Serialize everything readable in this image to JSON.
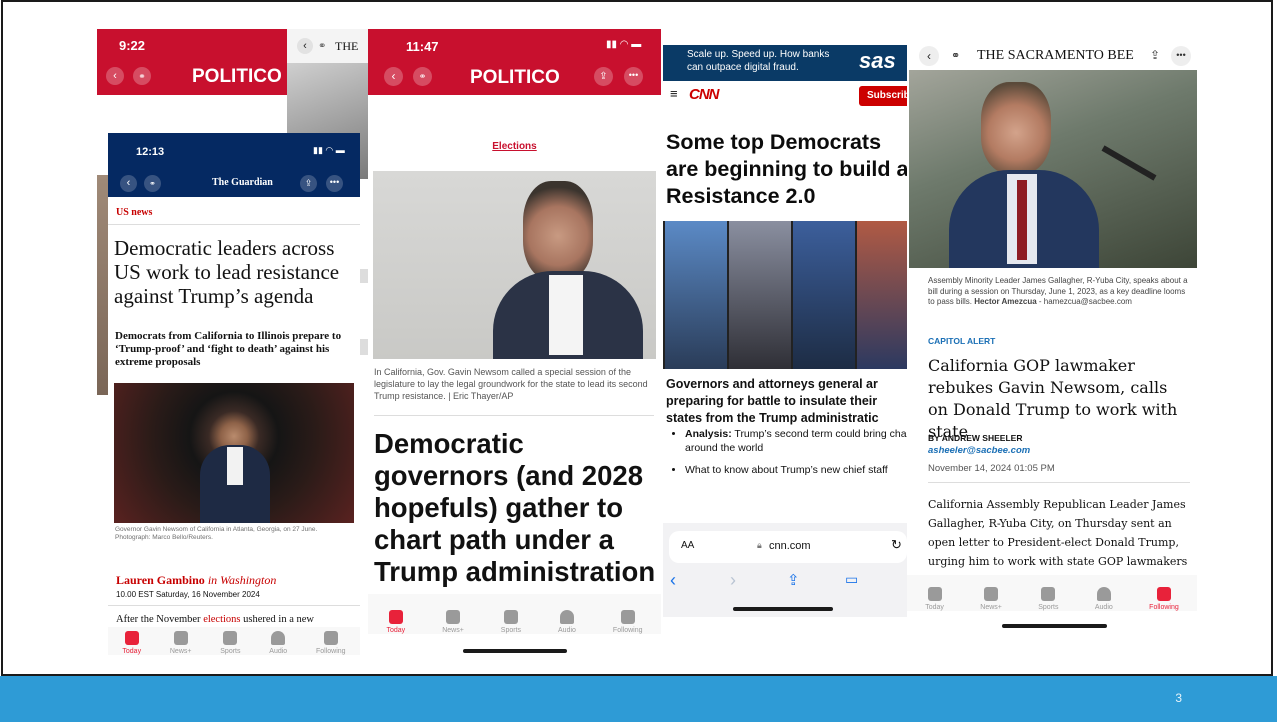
{
  "slide": {
    "page_number": "3"
  },
  "politico_back": {
    "time": "9:22",
    "brand": "POLITICO"
  },
  "sacbee_partial": {
    "brand": "THE"
  },
  "guardian": {
    "time": "12:13",
    "brand": "The Guardian",
    "section": "US news",
    "headline": "Democratic leaders across US work to lead resistance against Trump’s agenda",
    "standfirst": "Democrats from California to Illinois prepare to ‘Trump-proof’ and ‘fight to death’ against his extreme proposals",
    "caption": "Governor Gavin Newsom of California in Atlanta, Georgia, on 27 June. Photograph: Marco Bello/Reuters.",
    "author": "Lauren Gambino",
    "author_location": "in Washington",
    "dateline": "10.00 EST Saturday, 16 November 2024",
    "body_start": "After the November",
    "body_link": "elections",
    "body_end": "ushered in a new",
    "tabs": [
      "Today",
      "News+",
      "Sports",
      "Audio",
      "Following"
    ]
  },
  "politico": {
    "time": "11:47",
    "brand": "POLITICO",
    "section": "Elections",
    "caption": "In California, Gov. Gavin Newsom called a special session of the legislature to lay the legal groundwork for the state to lead its second Trump resistance. | Eric Thayer/AP",
    "headline": "Democratic governors (and 2028 hopefuls) gather to chart path under a Trump administration",
    "tabs": [
      "Today",
      "News+",
      "Sports",
      "Audio",
      "Following"
    ]
  },
  "cnn": {
    "ad_text": "Scale up. Speed up. How banks can outpace digital fraud.",
    "ad_brand": "sas",
    "brand": "CNN",
    "subscribe": "Subscrib",
    "headline": "Some top Democrats are beginning to build a Resistance 2.0",
    "subhead": "Governors and attorneys general ar preparing for battle to insulate their states from the Trump administratic",
    "bullets": [
      {
        "bold": "Analysis:",
        "text": " Trump’s second term could bring chaos around the world"
      },
      {
        "bold": "",
        "text": "What to know about Trump’s new chief staff"
      }
    ],
    "text_size": "AA",
    "url": "cnn.com"
  },
  "sacbee": {
    "brand": "THE SACRAMENTO BEE",
    "caption": "Assembly Minority Leader James Gallagher, R-Yuba City, speaks about a bill during a session on Thursday, June 1, 2023, as a key deadline looms to pass bills.",
    "caption_credit": "Hector Amezcua",
    "caption_email": "hamezcua@sacbee.com",
    "kicker": "CAPITOL ALERT",
    "headline": "California GOP lawmaker rebukes Gavin Newsom, calls on Donald Trump to work with state",
    "byline": "BY ANDREW SHEELER",
    "email": "asheeler@sacbee.com",
    "date": "November 14, 2024 01:05 PM",
    "body": "California Assembly Republican Leader James Gallagher, R-Yuba City, on Thursday sent an open letter to President-elect Donald Trump, urging him to work with state GOP lawmakers",
    "tabs": [
      "Today",
      "News+",
      "Sports",
      "Audio",
      "Following"
    ]
  },
  "colors": {
    "politico_red": "#c8102e",
    "guardian_blue": "#052962",
    "cnn_red": "#cc0000",
    "apple_news_red": "#e8223a",
    "footer_blue": "#2e9bd6"
  }
}
